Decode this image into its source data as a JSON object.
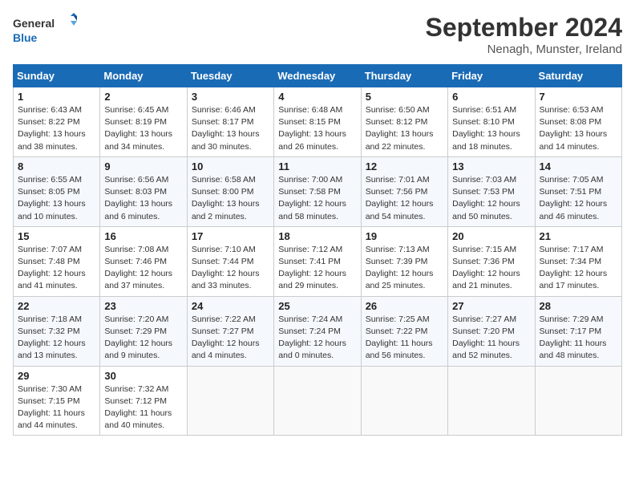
{
  "header": {
    "logo_line1": "General",
    "logo_line2": "Blue",
    "month": "September 2024",
    "location": "Nenagh, Munster, Ireland"
  },
  "days_of_week": [
    "Sunday",
    "Monday",
    "Tuesday",
    "Wednesday",
    "Thursday",
    "Friday",
    "Saturday"
  ],
  "weeks": [
    [
      {
        "day": "1",
        "info": "Sunrise: 6:43 AM\nSunset: 8:22 PM\nDaylight: 13 hours\nand 38 minutes."
      },
      {
        "day": "2",
        "info": "Sunrise: 6:45 AM\nSunset: 8:19 PM\nDaylight: 13 hours\nand 34 minutes."
      },
      {
        "day": "3",
        "info": "Sunrise: 6:46 AM\nSunset: 8:17 PM\nDaylight: 13 hours\nand 30 minutes."
      },
      {
        "day": "4",
        "info": "Sunrise: 6:48 AM\nSunset: 8:15 PM\nDaylight: 13 hours\nand 26 minutes."
      },
      {
        "day": "5",
        "info": "Sunrise: 6:50 AM\nSunset: 8:12 PM\nDaylight: 13 hours\nand 22 minutes."
      },
      {
        "day": "6",
        "info": "Sunrise: 6:51 AM\nSunset: 8:10 PM\nDaylight: 13 hours\nand 18 minutes."
      },
      {
        "day": "7",
        "info": "Sunrise: 6:53 AM\nSunset: 8:08 PM\nDaylight: 13 hours\nand 14 minutes."
      }
    ],
    [
      {
        "day": "8",
        "info": "Sunrise: 6:55 AM\nSunset: 8:05 PM\nDaylight: 13 hours\nand 10 minutes."
      },
      {
        "day": "9",
        "info": "Sunrise: 6:56 AM\nSunset: 8:03 PM\nDaylight: 13 hours\nand 6 minutes."
      },
      {
        "day": "10",
        "info": "Sunrise: 6:58 AM\nSunset: 8:00 PM\nDaylight: 13 hours\nand 2 minutes."
      },
      {
        "day": "11",
        "info": "Sunrise: 7:00 AM\nSunset: 7:58 PM\nDaylight: 12 hours\nand 58 minutes."
      },
      {
        "day": "12",
        "info": "Sunrise: 7:01 AM\nSunset: 7:56 PM\nDaylight: 12 hours\nand 54 minutes."
      },
      {
        "day": "13",
        "info": "Sunrise: 7:03 AM\nSunset: 7:53 PM\nDaylight: 12 hours\nand 50 minutes."
      },
      {
        "day": "14",
        "info": "Sunrise: 7:05 AM\nSunset: 7:51 PM\nDaylight: 12 hours\nand 46 minutes."
      }
    ],
    [
      {
        "day": "15",
        "info": "Sunrise: 7:07 AM\nSunset: 7:48 PM\nDaylight: 12 hours\nand 41 minutes."
      },
      {
        "day": "16",
        "info": "Sunrise: 7:08 AM\nSunset: 7:46 PM\nDaylight: 12 hours\nand 37 minutes."
      },
      {
        "day": "17",
        "info": "Sunrise: 7:10 AM\nSunset: 7:44 PM\nDaylight: 12 hours\nand 33 minutes."
      },
      {
        "day": "18",
        "info": "Sunrise: 7:12 AM\nSunset: 7:41 PM\nDaylight: 12 hours\nand 29 minutes."
      },
      {
        "day": "19",
        "info": "Sunrise: 7:13 AM\nSunset: 7:39 PM\nDaylight: 12 hours\nand 25 minutes."
      },
      {
        "day": "20",
        "info": "Sunrise: 7:15 AM\nSunset: 7:36 PM\nDaylight: 12 hours\nand 21 minutes."
      },
      {
        "day": "21",
        "info": "Sunrise: 7:17 AM\nSunset: 7:34 PM\nDaylight: 12 hours\nand 17 minutes."
      }
    ],
    [
      {
        "day": "22",
        "info": "Sunrise: 7:18 AM\nSunset: 7:32 PM\nDaylight: 12 hours\nand 13 minutes."
      },
      {
        "day": "23",
        "info": "Sunrise: 7:20 AM\nSunset: 7:29 PM\nDaylight: 12 hours\nand 9 minutes."
      },
      {
        "day": "24",
        "info": "Sunrise: 7:22 AM\nSunset: 7:27 PM\nDaylight: 12 hours\nand 4 minutes."
      },
      {
        "day": "25",
        "info": "Sunrise: 7:24 AM\nSunset: 7:24 PM\nDaylight: 12 hours\nand 0 minutes."
      },
      {
        "day": "26",
        "info": "Sunrise: 7:25 AM\nSunset: 7:22 PM\nDaylight: 11 hours\nand 56 minutes."
      },
      {
        "day": "27",
        "info": "Sunrise: 7:27 AM\nSunset: 7:20 PM\nDaylight: 11 hours\nand 52 minutes."
      },
      {
        "day": "28",
        "info": "Sunrise: 7:29 AM\nSunset: 7:17 PM\nDaylight: 11 hours\nand 48 minutes."
      }
    ],
    [
      {
        "day": "29",
        "info": "Sunrise: 7:30 AM\nSunset: 7:15 PM\nDaylight: 11 hours\nand 44 minutes."
      },
      {
        "day": "30",
        "info": "Sunrise: 7:32 AM\nSunset: 7:12 PM\nDaylight: 11 hours\nand 40 minutes."
      },
      {
        "day": "",
        "info": ""
      },
      {
        "day": "",
        "info": ""
      },
      {
        "day": "",
        "info": ""
      },
      {
        "day": "",
        "info": ""
      },
      {
        "day": "",
        "info": ""
      }
    ]
  ]
}
